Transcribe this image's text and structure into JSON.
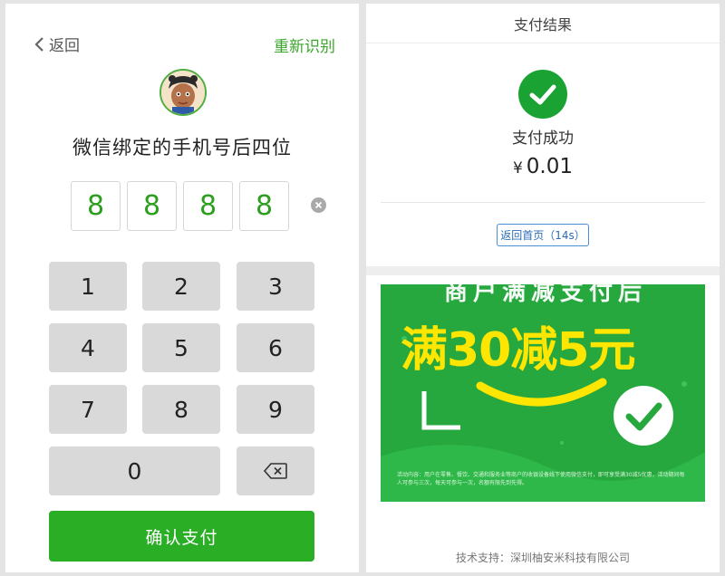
{
  "left": {
    "back_label": "返回",
    "reidentify_label": "重新识别",
    "title": "微信绑定的手机号后四位",
    "entered_digits": [
      "8",
      "8",
      "8",
      "8"
    ],
    "keypad": {
      "keys": [
        "1",
        "2",
        "3",
        "4",
        "5",
        "6",
        "7",
        "8",
        "9",
        "0"
      ],
      "delete_icon": "backspace-icon"
    },
    "confirm_label": "确认支付",
    "accent_color": "#2aae25"
  },
  "right": {
    "header_title": "支付结果",
    "status_icon": "checkmark-circle-icon",
    "status_text": "支付成功",
    "currency": "¥",
    "amount": "0.01",
    "home_button_label": "返回首页（14s）",
    "banner": {
      "headline_top": "商户满减支付后",
      "headline_main": "满30减5元",
      "fine_print": "活动内容：用户在零售、餐饮、交通和服务业等商户的收银设备线下使用微信支付，即可享受满30减5优惠，活动期间每人可参与三次，每天可参与一次，名额有限先到先得。"
    },
    "footer": "技术支持：深圳柚安米科技有限公司",
    "success_color": "#1aa332"
  }
}
